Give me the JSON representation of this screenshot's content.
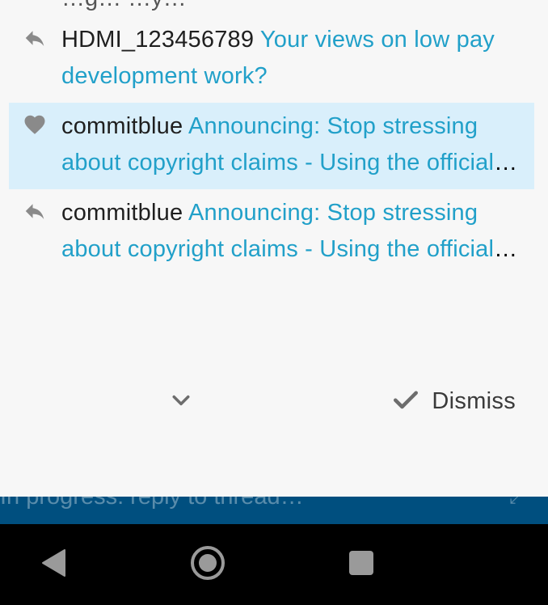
{
  "partial_row": {
    "text": "…g… …y…"
  },
  "notifications": [
    {
      "icon": "reply-icon",
      "user": "HDMI_123456789",
      "title": "Your views on low pay development work?",
      "highlighted": false
    },
    {
      "icon": "heart-icon",
      "user": "commitblue",
      "title": "Announcing: Stop stressing about copyright claims - Using the official VIVA music library",
      "highlighted": true
    },
    {
      "icon": "reply-icon",
      "user": "commitblue",
      "title": "Announcing: Stop stressing about copyright claims - Using the official VIVA music library",
      "highlighted": false
    }
  ],
  "footer": {
    "expand_icon": "chevron-down-icon",
    "dismiss_icon": "check-icon",
    "dismiss_label": "Dismiss"
  },
  "composer": {
    "hint": "In progress: reply to thread…"
  },
  "colors": {
    "highlight": "#d9effb",
    "link": "#21a0c9",
    "composer": "#004f7f",
    "icon": "#8a8a8a"
  },
  "nav": {
    "back_icon": "back-triangle-icon",
    "home_icon": "home-circle-icon",
    "recents_icon": "recents-square-icon"
  }
}
